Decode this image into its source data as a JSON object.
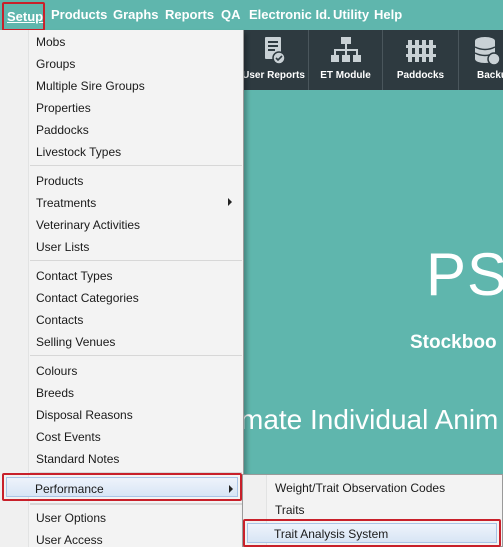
{
  "menubar": {
    "items": [
      "Setup",
      "Products",
      "Graphs",
      "Reports",
      "QA",
      "Electronic Id.",
      "Utility",
      "Help"
    ]
  },
  "toolbar": {
    "buttons": [
      {
        "label": "User Reports",
        "icon": "report-icon"
      },
      {
        "label": "ET Module",
        "icon": "network-icon"
      },
      {
        "label": "Paddocks",
        "icon": "fence-icon"
      },
      {
        "label": "Backu",
        "icon": "database-icon"
      }
    ]
  },
  "background": {
    "brand": "PS",
    "tagline1": "Stockboo",
    "tagline2": "mate Individual Anim"
  },
  "setup_menu": {
    "group1": [
      "Mobs",
      "Groups",
      "Multiple Sire Groups",
      "Properties",
      "Paddocks",
      "Livestock Types"
    ],
    "group2": [
      "Products",
      "Treatments",
      "Veterinary Activities",
      "User Lists"
    ],
    "group3": [
      "Contact Types",
      "Contact Categories",
      "Contacts",
      "Selling Venues"
    ],
    "group4": [
      "Colours",
      "Breeds",
      "Disposal Reasons",
      "Cost Events",
      "Standard Notes"
    ],
    "performance": "Performance",
    "group5": [
      "User Options",
      "User Access"
    ]
  },
  "performance_submenu": {
    "items": [
      "Weight/Trait Observation Codes",
      "Traits",
      "Trait Analysis System"
    ]
  },
  "colors": {
    "background_teal": "#5fb6ad",
    "toolbar_dark": "#2e3a40",
    "highlight_red": "#c8202a"
  }
}
